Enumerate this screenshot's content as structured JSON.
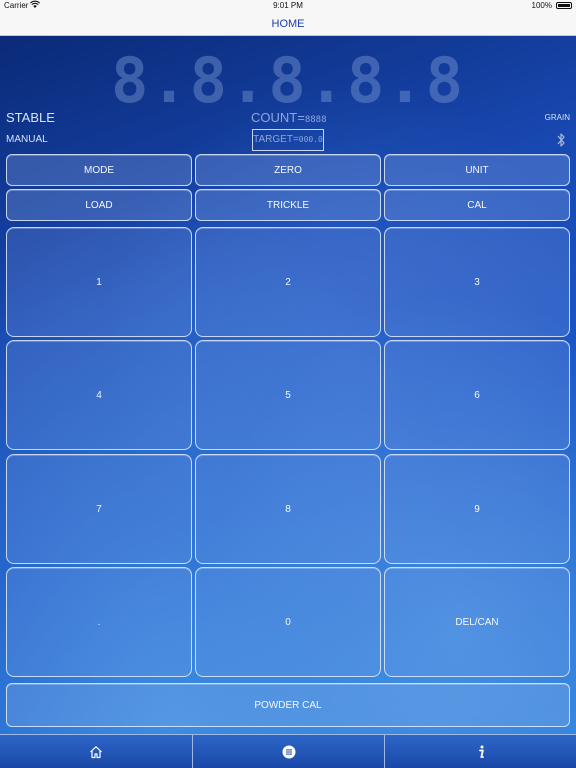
{
  "status_bar": {
    "carrier": "Carrier",
    "time": "9:01 PM",
    "battery": "100%"
  },
  "nav": {
    "title": "HOME"
  },
  "display": {
    "digits": "8.8.8.8.8",
    "status": "STABLE",
    "count_label": "COUNT=",
    "count_value": "8888",
    "unit": "GRAIN",
    "mode": "MANUAL",
    "target_label": "TARGET=",
    "target_value": "000.0"
  },
  "function_buttons": {
    "mode": "MODE",
    "zero": "ZERO",
    "unit": "UNIT",
    "load": "LOAD",
    "trickle": "TRICKLE",
    "cal": "CAL"
  },
  "keypad": {
    "k1": "1",
    "k2": "2",
    "k3": "3",
    "k4": "4",
    "k5": "5",
    "k6": "6",
    "k7": "7",
    "k8": "8",
    "k9": "9",
    "dot": ".",
    "k0": "0",
    "delcan": "DEL/CAN"
  },
  "powder_cal": "POWDER CAL",
  "tabs": {
    "home_icon": "home-icon",
    "menu_icon": "list-icon",
    "info_icon": "info-icon"
  },
  "colors": {
    "nav_title": "#1a3fa8",
    "background": "#1849b3",
    "tab_bar": "#2d66c8"
  }
}
